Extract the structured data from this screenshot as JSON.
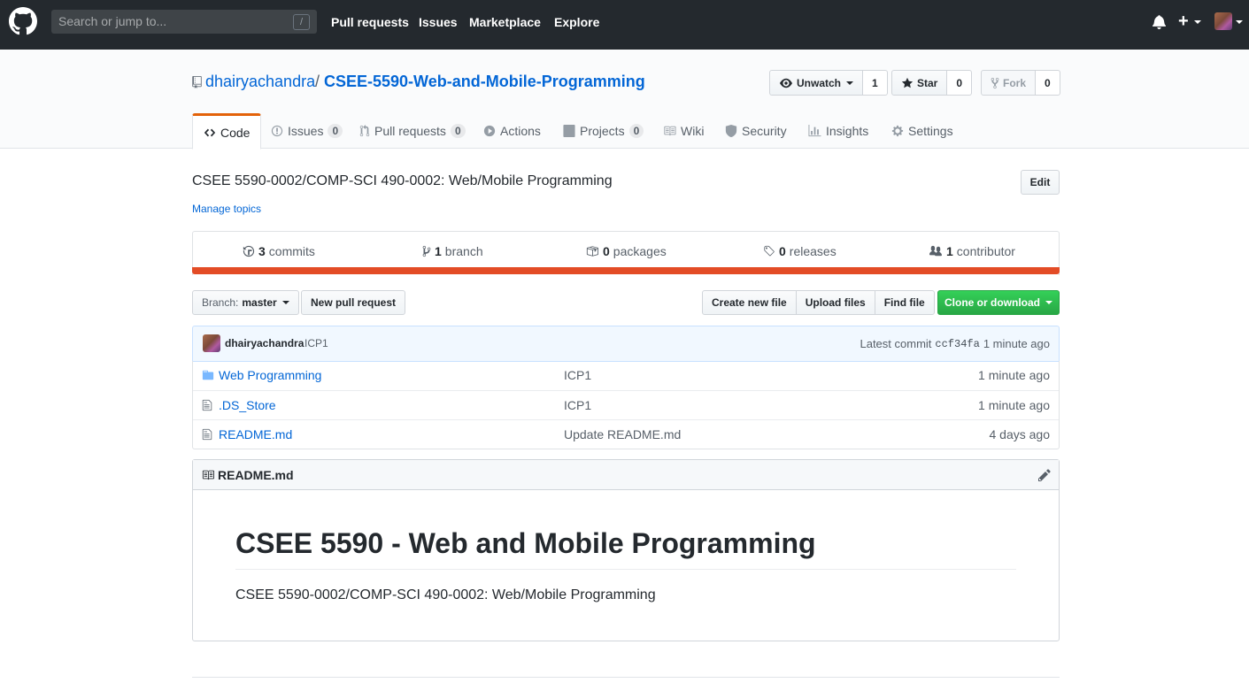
{
  "header": {
    "search_placeholder": "Search or jump to...",
    "search_shortcut": "/",
    "nav": [
      "Pull requests",
      "Issues",
      "Marketplace",
      "Explore"
    ]
  },
  "repo": {
    "owner": "dhairyachandra",
    "separator": "/",
    "name": "CSEE-5590-Web-and-Mobile-Programming",
    "unwatch_label": "Unwatch",
    "watch_count": "1",
    "star_label": "Star",
    "star_count": "0",
    "fork_label": "Fork",
    "fork_count": "0"
  },
  "tabs": [
    {
      "label": "Code",
      "icon": "code-icon"
    },
    {
      "label": "Issues",
      "count": "0",
      "icon": "issue-icon"
    },
    {
      "label": "Pull requests",
      "count": "0",
      "icon": "pull-request-icon"
    },
    {
      "label": "Actions",
      "icon": "play-icon"
    },
    {
      "label": "Projects",
      "count": "0",
      "icon": "project-icon"
    },
    {
      "label": "Wiki",
      "icon": "book-icon"
    },
    {
      "label": "Security",
      "icon": "shield-icon"
    },
    {
      "label": "Insights",
      "icon": "graph-icon"
    },
    {
      "label": "Settings",
      "icon": "gear-icon"
    }
  ],
  "about": {
    "description": "CSEE 5590-0002/COMP-SCI 490-0002: Web/Mobile Programming",
    "manage_topics": "Manage topics",
    "edit_label": "Edit"
  },
  "summary": {
    "commits": {
      "num": "3",
      "label": "commits"
    },
    "branches": {
      "num": "1",
      "label": "branch"
    },
    "packages": {
      "num": "0",
      "label": "packages"
    },
    "releases": {
      "num": "0",
      "label": "releases"
    },
    "contributors": {
      "num": "1",
      "label": "contributor"
    },
    "language_color": "#e34c26"
  },
  "toolbar": {
    "branch_prefix": "Branch:",
    "branch_name": "master",
    "new_pull_request": "New pull request",
    "create_new_file": "Create new file",
    "upload_files": "Upload files",
    "find_file": "Find file",
    "clone_or_download": "Clone or download"
  },
  "latest_commit": {
    "author": "dhairyachandra",
    "message": "ICP1",
    "label": "Latest commit",
    "sha": "ccf34fa",
    "age": "1 minute ago"
  },
  "files": [
    {
      "name": "Web Programming",
      "type": "folder",
      "message": "ICP1",
      "age": "1 minute ago"
    },
    {
      "name": ".DS_Store",
      "type": "file",
      "message": "ICP1",
      "age": "1 minute ago"
    },
    {
      "name": "README.md",
      "type": "file",
      "message": "Update README.md",
      "age": "4 days ago"
    }
  ],
  "readme": {
    "filename": "README.md",
    "heading": "CSEE 5590 - Web and Mobile Programming",
    "paragraph": "CSEE 5590-0002/COMP-SCI 490-0002: Web/Mobile Programming"
  }
}
